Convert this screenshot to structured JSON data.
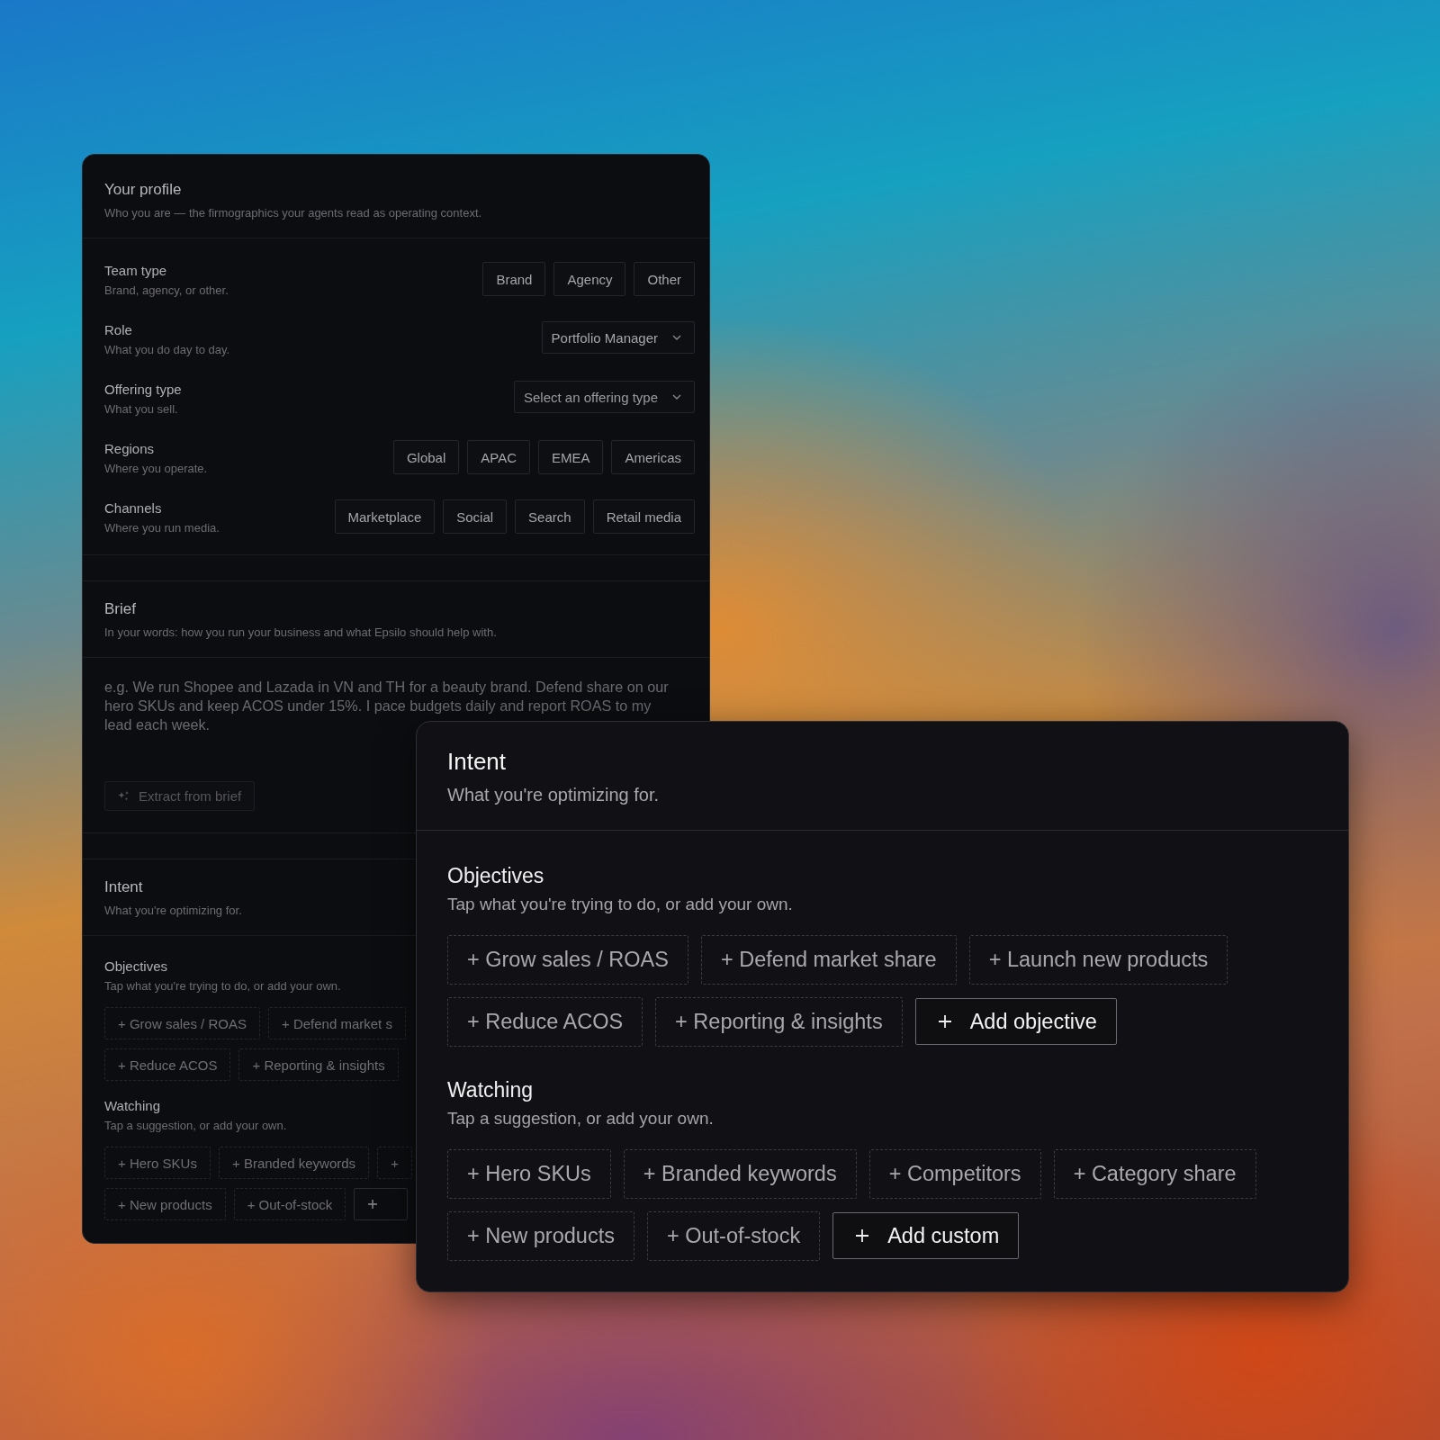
{
  "profile_window": {
    "profile": {
      "title": "Your profile",
      "subtitle": "Who you are — the firmographics your agents read as operating context.",
      "fields": [
        {
          "kind": "chips",
          "label": "Team type",
          "hint": "Brand, agency, or other.",
          "options": [
            "Brand",
            "Agency",
            "Other"
          ]
        },
        {
          "kind": "select",
          "label": "Role",
          "hint": "What you do day to day.",
          "value": "Portfolio Manager"
        },
        {
          "kind": "select",
          "label": "Offering type",
          "hint": "What you sell.",
          "placeholder": "Select an offering type"
        },
        {
          "kind": "chips",
          "label": "Regions",
          "hint": "Where you operate.",
          "options": [
            "Global",
            "APAC",
            "EMEA",
            "Americas"
          ]
        },
        {
          "kind": "chips",
          "label": "Channels",
          "hint": "Where you run media.",
          "options": [
            "Marketplace",
            "Social",
            "Search",
            "Retail media"
          ]
        }
      ]
    },
    "brief": {
      "title": "Brief",
      "subtitle": "In your words: how you run your business and what Epsilo should help with.",
      "placeholder": "e.g. We run Shopee and Lazada in VN and TH for a beauty brand. Defend share on our hero SKUs and keep ACOS under 15%. I pace budgets daily and report ROAS to my lead each week.",
      "extract_button": {
        "label": "Extract from brief",
        "disabled": true
      }
    },
    "intent": {
      "title": "Intent",
      "subtitle": "What you're optimizing for.",
      "objectives": {
        "title": "Objectives",
        "subtitle": "Tap what you're trying to do, or add your own.",
        "rows": [
          [
            "+ Grow sales / ROAS",
            "+ Defend market s"
          ],
          [
            "+ Reduce ACOS",
            "+ Reporting & insights"
          ]
        ]
      },
      "watching": {
        "title": "Watching",
        "subtitle": "Tap a suggestion, or add your own.",
        "rows": [
          [
            "+ Hero SKUs",
            "+ Branded keywords",
            "+"
          ],
          [
            "+ New products",
            "+ Out-of-stock"
          ]
        ],
        "add_button_cut": true
      }
    }
  },
  "intent_window": {
    "title": "Intent",
    "subtitle": "What you're optimizing for.",
    "groups": [
      {
        "title": "Objectives",
        "subtitle": "Tap what you're trying to do, or add your own.",
        "suggestions": [
          "+ Grow sales / ROAS",
          "+ Defend market share",
          "+ Launch new products",
          "+ Reduce ACOS",
          "+ Reporting & insights"
        ],
        "add_label": "Add objective"
      },
      {
        "title": "Watching",
        "subtitle": "Tap a suggestion, or add your own.",
        "suggestions": [
          "+ Hero SKUs",
          "+ Branded keywords",
          "+ Competitors",
          "+ Category share",
          "+ New products",
          "+ Out-of-stock"
        ],
        "add_label": "Add custom"
      }
    ]
  }
}
